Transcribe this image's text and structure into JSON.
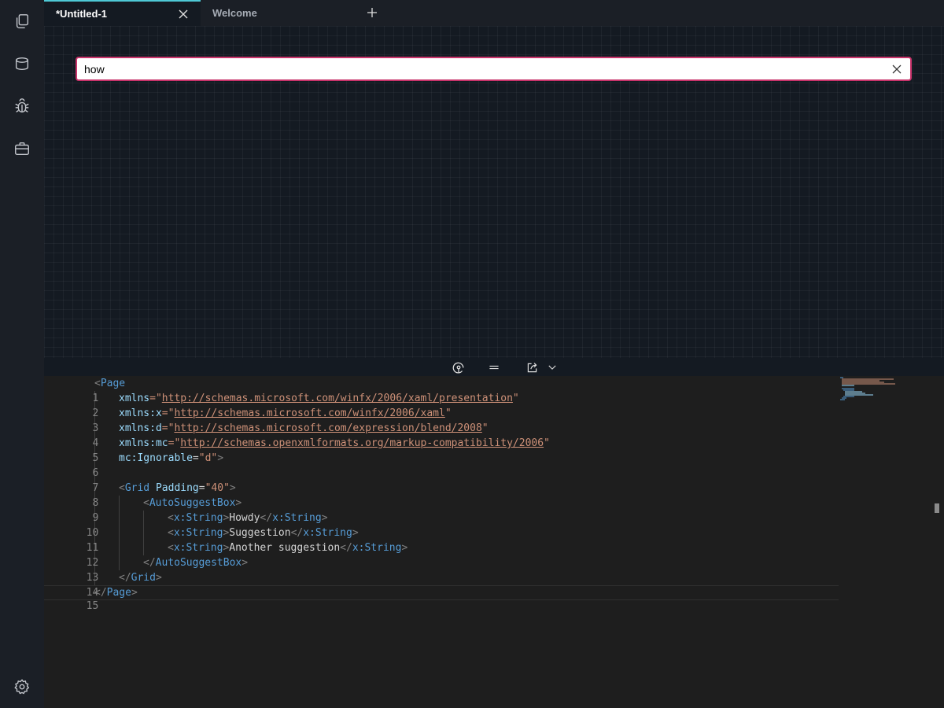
{
  "tabs": [
    {
      "label": "*Untitled-1",
      "active": true
    },
    {
      "label": "Welcome",
      "active": false
    }
  ],
  "activity_icons": [
    "copy-icon",
    "database-icon",
    "bug-icon",
    "briefcase-icon"
  ],
  "settings_icon": "gear-icon",
  "canvas": {
    "suggest_box": {
      "value": "how"
    }
  },
  "split_toolbar": {
    "icons": [
      "rotate-view-icon",
      "split-layout-icon",
      "share-icon",
      "chevron-down-icon"
    ]
  },
  "editor": {
    "line_numbers": [
      "1",
      "2",
      "3",
      "4",
      "5",
      "6",
      "7",
      "8",
      "9",
      "10",
      "11",
      "12",
      "13",
      "14",
      "15"
    ],
    "lines": {
      "l1": {
        "open": "<",
        "tag": "Page"
      },
      "l2": {
        "attr": "xmlns",
        "eq": "=\"",
        "url": "http://schemas.microsoft.com/winfx/2006/xaml/presentation",
        "close": "\""
      },
      "l3": {
        "attr": "xmlns:x",
        "eq": "=\"",
        "url": "http://schemas.microsoft.com/winfx/2006/xaml",
        "close": "\""
      },
      "l4": {
        "attr": "xmlns:d",
        "eq": "=\"",
        "url": "http://schemas.microsoft.com/expression/blend/2008",
        "close": "\""
      },
      "l5": {
        "attr": "xmlns:mc",
        "eq": "=\"",
        "url": "http://schemas.openxmlformats.org/markup-compatibility/2006",
        "close": "\""
      },
      "l6": {
        "attr": "mc:Ignorable",
        "eq": "=",
        "str": "\"d\"",
        "close": ">"
      },
      "l8": {
        "open": "<",
        "tag": "Grid",
        "attr": " Padding",
        "eq": "=",
        "str": "\"40\"",
        "close": ">"
      },
      "l9": {
        "open": "<",
        "tag": "AutoSuggestBox",
        "close": ">"
      },
      "l10": {
        "open": "<",
        "tag": "x:String",
        "close": ">",
        "text": "Howdy",
        "open2": "</",
        "tag2": "x:String",
        "close2": ">"
      },
      "l11": {
        "open": "<",
        "tag": "x:String",
        "close": ">",
        "text": "Suggestion",
        "open2": "</",
        "tag2": "x:String",
        "close2": ">"
      },
      "l12": {
        "open": "<",
        "tag": "x:String",
        "close": ">",
        "text": "Another suggestion",
        "open2": "</",
        "tag2": "x:String",
        "close2": ">"
      },
      "l13": {
        "open": "</",
        "tag": "AutoSuggestBox",
        "close": ">"
      },
      "l14": {
        "open": "</",
        "tag": "Grid",
        "close": ">"
      },
      "l15": {
        "open": "</",
        "tag": "Page",
        "close": ">"
      }
    }
  },
  "colors": {
    "accent_tab": "#4ec9d6",
    "suggest_border": "#c8336a",
    "tag": "#569cd6",
    "attribute": "#9cdcfe",
    "string": "#ce9178"
  }
}
